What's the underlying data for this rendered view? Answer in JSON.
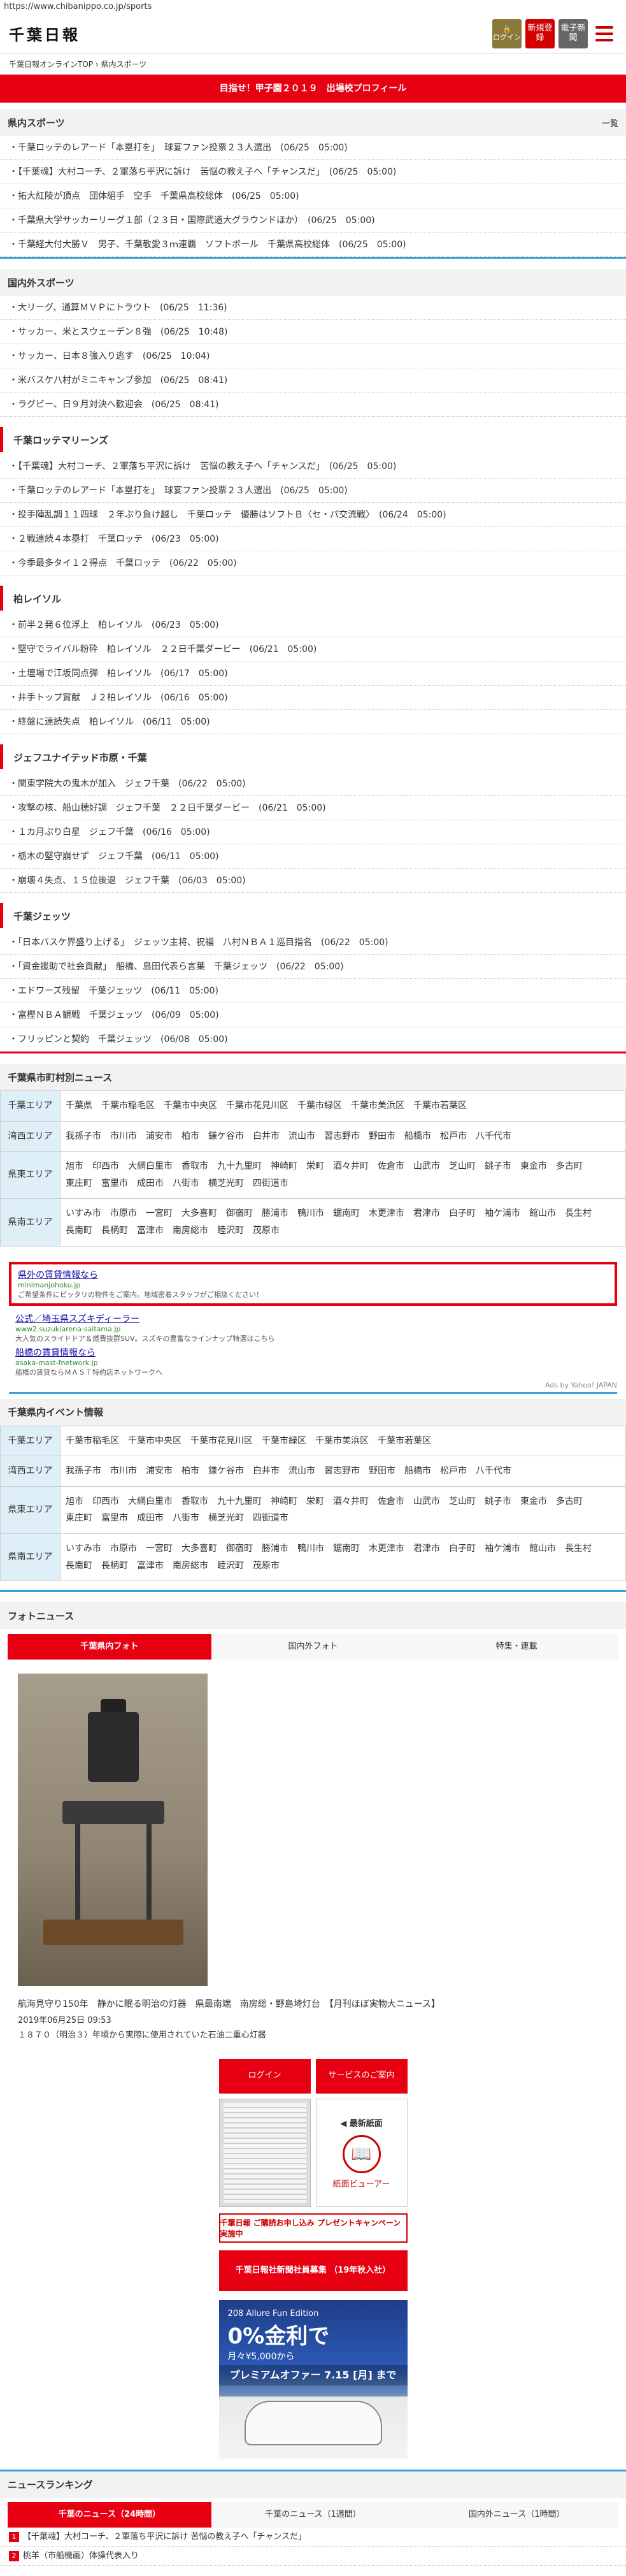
{
  "browser": {
    "url": "https://www.chibanippo.co.jp/sports"
  },
  "header": {
    "logo": "千葉日報",
    "login_label": "ログイン",
    "signup_label": "新規登録",
    "paper_label": "電子新聞"
  },
  "breadcrumb": "千葉日報オンラインTOP › 県内スポーツ",
  "banner": "目指せ！甲子園２０１９　出場校プロフィール",
  "prefecture_sports": {
    "title": "県内スポーツ",
    "more": "一覧",
    "items": [
      "・千葉ロッテのレアード「本塁打を」　球宴ファン投票２３人選出　(06/25　05:00)",
      "・【千葉魂】大村コーチ、２軍落ち平沢に訴け　苦悩の教え子へ「チャンスだ」　(06/25　05:00)",
      "・拓大紅陵が頂点　団体組手　空手　千葉県高校総体　(06/25　05:00)",
      "・千葉県大学サッカーリーグ１部（２３日・国際武道大グラウンドほか）　(06/25　05:00)",
      "・千葉経大付大勝Ｖ　男子、千葉敬愛３ｍ連覇　ソフトボール　千葉県高校総体　(06/25　05:00)"
    ]
  },
  "domestic_sports": {
    "title": "国内外スポーツ",
    "items": [
      "・大リーグ、通算ＭＶＰにトラウト　(06/25　11:36)",
      "・サッカー、米とスウェーデン８強　(06/25　10:48)",
      "・サッカー、日本８強入り逃す　(06/25　10:04)",
      "・米バスケ八村がミニキャンプ参加　(06/25　08:41)",
      "・ラグビー、日９月対決へ歓迎会　(06/25　08:41)"
    ]
  },
  "marines": {
    "title": "千葉ロッテマリーンズ",
    "items": [
      "・【千葉魂】大村コーチ、２軍落ち平沢に訴け　苦悩の教え子へ「チャンスだ」　(06/25　05:00)",
      "・千葉ロッテのレアード「本塁打を」　球宴ファン投票２３人選出　(06/25　05:00)",
      "・投手陣乱調１１四球　２年ぶり負け越し　千葉ロッテ　優勝はソフトＢ〈セ・パ交流戦〉　(06/24　05:00)",
      "・２戦連続４本塁打　千葉ロッテ　(06/23　05:00)",
      "・今季最多タイ１２得点　千葉ロッテ　(06/22　05:00)"
    ]
  },
  "reysol": {
    "title": "柏レイソル",
    "items": [
      "・前半２発６位浮上　柏レイソル　(06/23　05:00)",
      "・堅守でライバル粉砕　柏レイソル　２２日千葉ダービー　(06/21　05:00)",
      "・土壇場で江坂同点弾　柏レイソル　(06/17　05:00)",
      "・井手トップ賞献　Ｊ２柏レイソル　(06/16　05:00)",
      "・終盤に連続失点　柏レイソル　(06/11　05:00)"
    ]
  },
  "jef": {
    "title": "ジェフユナイテッド市原・千葉",
    "items": [
      "・関東学院大の鬼木が加入　ジェフ千葉　(06/22　05:00)",
      "・攻撃の核、船山穂好調　ジェフ千葉　２２日千葉ダービー　(06/21　05:00)",
      "・１カ月ぶり白星　ジェフ千葉　(06/16　05:00)",
      "・栃木の堅守崩せず　ジェフ千葉　(06/11　05:00)",
      "・崩壊４失点、１５位後退　ジェフ千葉　(06/03　05:00)"
    ]
  },
  "jets": {
    "title": "千葉ジェッツ",
    "items": [
      "・「日本バスケ界盛り上げる」　ジェッツ主将、祝福　八村ＮＢＡ１巡目指名　(06/22　05:00)",
      "・「資金援助で社会貢献」　船橋、島田代表ら言葉　千葉ジェッツ　(06/22　05:00)",
      "・エドワーズ残留　千葉ジェッツ　(06/11　05:00)",
      "・富樫ＮＢＡ観戦　千葉ジェッツ　(06/09　05:00)",
      "・フリッピンと契約　千葉ジェッツ　(06/08　05:00)"
    ]
  },
  "city_news": {
    "title": "千葉県市町村別ニュース",
    "areas": [
      {
        "name": "千葉エリア",
        "cities": [
          "千葉県",
          "千葉市稲毛区",
          "千葉市中央区",
          "千葉市花見川区",
          "千葉市緑区",
          "千葉市美浜区",
          "千葉市若葉区"
        ]
      },
      {
        "name": "湾西エリア",
        "cities": [
          "我孫子市",
          "市川市",
          "浦安市",
          "柏市",
          "鎌ケ谷市",
          "白井市",
          "流山市",
          "習志野市",
          "野田市",
          "船橋市",
          "松戸市",
          "八千代市"
        ]
      },
      {
        "name": "県東エリア",
        "cities": [
          "旭市",
          "印西市",
          "大網白里市",
          "香取市",
          "九十九里町",
          "神崎町",
          "栄町",
          "酒々井町",
          "佐倉市",
          "山武市",
          "芝山町",
          "銚子市",
          "東金市",
          "多古町",
          "東庄町",
          "富里市",
          "成田市",
          "八街市",
          "横芝光町",
          "四街道市"
        ]
      },
      {
        "name": "県南エリア",
        "cities": [
          "いすみ市",
          "市原市",
          "一宮町",
          "大多喜町",
          "御宿町",
          "勝浦市",
          "鴨川市",
          "鋸南町",
          "木更津市",
          "君津市",
          "白子町",
          "袖ケ浦市",
          "館山市",
          "長生村",
          "長南町",
          "長柄町",
          "富津市",
          "南房総市",
          "睦沢町",
          "茂原市"
        ]
      }
    ]
  },
  "ads": {
    "highlight": {
      "title": "県外の賃貸情報なら",
      "url": "minimanjohoku.jp",
      "desc": "ご希望条件にピッタリの物件をご案内。地域密着スタッフがご相談ください！"
    },
    "items": [
      {
        "title": "公式／埼玉県スズキディーラー",
        "url": "www2.suzukiarena-saitama.jp",
        "desc": "大人気のスライドドア＆燃費抜群SUV。スズキの豊富なラインナップ特選はこちら"
      },
      {
        "title": "船橋の賃貸情報なら",
        "url": "asaka-mast-fnetwork.jp",
        "desc": "船橋の賃貸ならＭＡＳＴ特約店ネットワークへ"
      }
    ],
    "by": "Ads by Yahoo! JAPAN"
  },
  "events": {
    "title": "千葉県内イベント情報",
    "areas": [
      {
        "name": "千葉エリア",
        "cities": [
          "千葉市稲毛区",
          "千葉市中央区",
          "千葉市花見川区",
          "千葉市緑区",
          "千葉市美浜区",
          "千葉市若葉区"
        ]
      },
      {
        "name": "湾西エリア",
        "cities": [
          "我孫子市",
          "市川市",
          "浦安市",
          "柏市",
          "鎌ケ谷市",
          "白井市",
          "流山市",
          "習志野市",
          "野田市",
          "船橋市",
          "松戸市",
          "八千代市"
        ]
      },
      {
        "name": "県東エリア",
        "cities": [
          "旭市",
          "印西市",
          "大網白里市",
          "香取市",
          "九十九里町",
          "神崎町",
          "栄町",
          "酒々井町",
          "佐倉市",
          "山武市",
          "芝山町",
          "銚子市",
          "東金市",
          "多古町",
          "東庄町",
          "富里市",
          "成田市",
          "八街市",
          "横芝光町",
          "四街道市"
        ]
      },
      {
        "name": "県南エリア",
        "cities": [
          "いすみ市",
          "市原市",
          "一宮町",
          "大多喜町",
          "御宿町",
          "勝浦市",
          "鴨川市",
          "鋸南町",
          "木更津市",
          "君津市",
          "白子町",
          "袖ケ浦市",
          "館山市",
          "長生村",
          "長南町",
          "長柄町",
          "富津市",
          "南房総市",
          "睦沢町",
          "茂原市"
        ]
      }
    ]
  },
  "photo_news": {
    "title": "フォトニュース",
    "tabs": [
      "千葉県内フォト",
      "国内外フォト",
      "特集・連載"
    ],
    "caption": "航海見守り150年　静かに眠る明治の灯器　県最南端　南房総・野島埼灯台　【月刊ほぼ実物大ニュース】",
    "date": "2019年06月25日 09:53",
    "desc": "１８７０（明治３）年頃から実際に使用されていた石油二重心灯器"
  },
  "promo": {
    "login": "ログイン",
    "service": "サービスのご案内",
    "latest": "◀ 最新紙面",
    "viewer": "紙面ビューアー",
    "campaign": "千葉日報 ご購読お申し込み プレゼントキャンペーン実施中",
    "recruit": "千葉日報社新聞社員募集 （19年秋入社）",
    "car": {
      "t1": "208 Allure Fun Edition",
      "t2": "0%金利で",
      "t3": "月々¥5,000から",
      "offer": "プレミアムオファー 7.15 [月] まで"
    }
  },
  "ranking": {
    "title": "ニュースランキング",
    "tabs": [
      "千葉のニュース（24時間）",
      "千葉のニュース（1週間）",
      "国内外ニュース（1時間）"
    ],
    "items": [
      "【千葉魂】大村コーチ、２軍落ち平沢に訴け 苦悩の教え子へ「チャンスだ」",
      "桃羊（市船機画）体操代表入り"
    ]
  }
}
